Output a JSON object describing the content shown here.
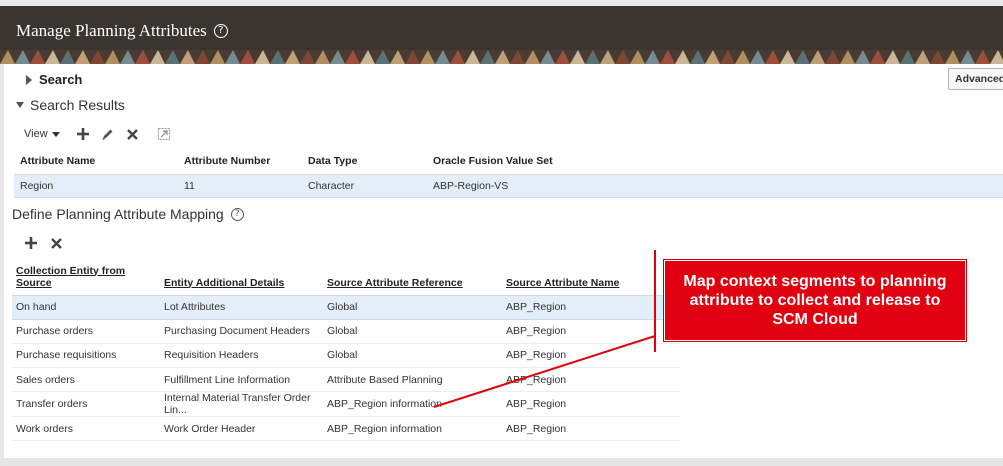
{
  "header": {
    "title": "Manage Planning Attributes",
    "help": "?"
  },
  "search": {
    "label": "Search",
    "advanced_button": "Advanced"
  },
  "results": {
    "title": "Search Results",
    "toolbar": {
      "view_label": "View"
    },
    "columns": [
      "Attribute Name",
      "Attribute Number",
      "Data Type",
      "Oracle Fusion Value Set"
    ],
    "rows": [
      [
        "Region",
        "11",
        "Character",
        "ABP-Region-VS"
      ]
    ]
  },
  "mapping": {
    "title": "Define Planning Attribute Mapping",
    "help": "?",
    "columns": [
      "Collection Entity from Source",
      "Entity Additional Details",
      "Source Attribute Reference",
      "Source Attribute Name"
    ],
    "rows": [
      [
        "On hand",
        "Lot Attributes",
        "Global",
        "ABP_Region"
      ],
      [
        "Purchase orders",
        "Purchasing Document Headers",
        "Global",
        "ABP_Region"
      ],
      [
        "Purchase requisitions",
        "Requisition Headers",
        "Global",
        "ABP_Region"
      ],
      [
        "Sales orders",
        "Fulfillment Line Information",
        "Attribute Based Planning",
        "ABP_Region"
      ],
      [
        "Transfer orders",
        "Internal Material Transfer Order Lin...",
        "ABP_Region information",
        "ABP_Region"
      ],
      [
        "Work orders",
        "Work Order Header",
        "ABP_Region information",
        "ABP_Region"
      ]
    ]
  },
  "callout": {
    "text": "Map context segments to planning attribute to collect and release to SCM Cloud"
  },
  "colors": {
    "header_bg": "#3a3531",
    "selected_row": "#e3eef9",
    "callout_red": "#e0000f"
  }
}
